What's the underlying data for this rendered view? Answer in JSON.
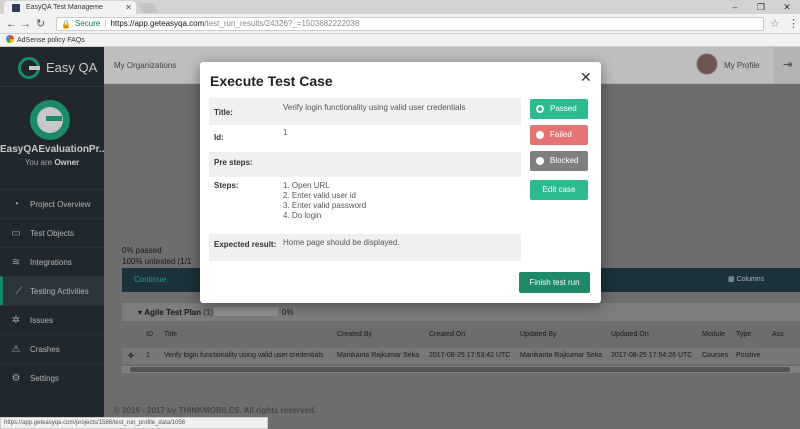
{
  "browser": {
    "tab_title": "EasyQA Test Manageme",
    "secure_label": "Secure",
    "url_host": "https://app.geteasyqa.com",
    "url_path": "/test_run_results/24326?_=1503682222038",
    "bookmark": "AdSense policy FAQs",
    "status_url": "https://app.geteasyqa.com/projects/1586/test_run_profile_data/1056"
  },
  "sidebar": {
    "brand": "Easy QA",
    "org_name": "EasyQAEvaluationPr...",
    "role_prefix": "You are",
    "role": "Owner",
    "items": [
      {
        "label": "Project Overview",
        "icon": "speedometer-icon"
      },
      {
        "label": "Test Objects",
        "icon": "folder-icon"
      },
      {
        "label": "Integrations",
        "icon": "layers-icon"
      },
      {
        "label": "Testing Activities",
        "icon": "chart-icon"
      },
      {
        "label": "Issues",
        "icon": "bug-icon"
      },
      {
        "label": "Crashes",
        "icon": "warning-icon"
      },
      {
        "label": "Settings",
        "icon": "gear-icon"
      }
    ]
  },
  "topbar": {
    "organizations": "My Organizations",
    "profile": "My Profile"
  },
  "content": {
    "passed_stat": "0% passed",
    "untested_stat": "100% untested (1/1",
    "continue": "Continue",
    "columns": "Columns",
    "plan_title": "Agile Test Plan",
    "plan_count": "(1)",
    "plan_pct": "0%",
    "headers": [
      "ID",
      "Title",
      "Created By",
      "Created On",
      "Updated By",
      "Updated On",
      "Module",
      "Type",
      "Ass"
    ],
    "row": {
      "id": "1",
      "title": "Verify login functionality using valid user credentials",
      "created_by": "Manikanta Rajkumar Seka",
      "created_on": "2017-08-25 17:53:42 UTC",
      "updated_by": "Manikanta Rajkumar Seka",
      "updated_on": "2017-08-25 17:54:26 UTC",
      "module": "Courses",
      "type": "Positive"
    },
    "footer": "© 2016 - 2017 by THINKMOBILES. All rights reserved."
  },
  "modal": {
    "title": "Execute Test Case",
    "title_label": "Title:",
    "title_value": "Verify login functionality using valid user credentials",
    "id_label": "Id:",
    "id_value": "1",
    "presteps_label": "Pre steps:",
    "steps_label": "Steps:",
    "steps": [
      "1. Open URL",
      "2. Enter valid user id",
      "3. Enter valid password",
      "4. Do login"
    ],
    "expected_label": "Expected result:",
    "expected_value": "Home page should be displayed.",
    "passed": "Passed",
    "failed": "Failed",
    "blocked": "Blocked",
    "edit_case": "Edit case",
    "finish": "Finish test run"
  }
}
